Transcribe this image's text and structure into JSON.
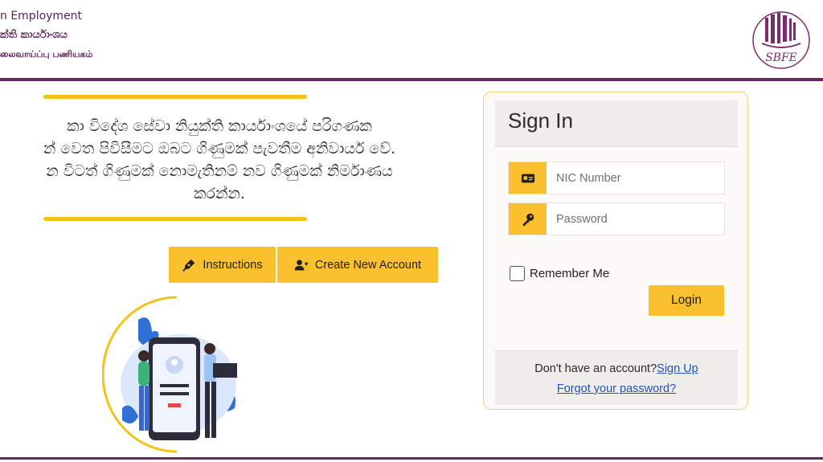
{
  "header": {
    "line1": "n Employment",
    "line2": "ක්ති කාර්යාංශය",
    "line3": "லைவாய்ப்பு பணியகம்",
    "logo_text": "SBFE"
  },
  "message": {
    "line1": "කා විදේශ සේවා නියුක්ති කාර්යාංශයේ පරිගණක",
    "line2": "න් වෙත පිවිසීමට ඔබට ගිණුමක් පැවතීම අනිවාර්ය වේ.",
    "line3": "න විටත් ගිණුමක් නොමැතිනම් නව ගිණුමක් නිර්මාණය",
    "line4": "කරන්න."
  },
  "buttons": {
    "instructions_label": "Instructions",
    "create_account_label": "Create New Account"
  },
  "signin": {
    "title": "Sign In",
    "nic_placeholder": "NIC Number",
    "password_placeholder": "Password",
    "remember_label": "Remember Me",
    "remember_checked": false,
    "login_label": "Login",
    "no_account_text": "Don't have an account?",
    "signup_link": "Sign Up",
    "forgot_link": "Forgot your password?"
  },
  "colors": {
    "accent_yellow": "#fbc02d",
    "brand_purple": "#6b2762",
    "link_blue": "#2453b5"
  },
  "icons": {
    "instructions": "pen-nib-icon",
    "create_account": "user-plus-icon",
    "nic": "id-card-icon",
    "password": "key-icon"
  }
}
